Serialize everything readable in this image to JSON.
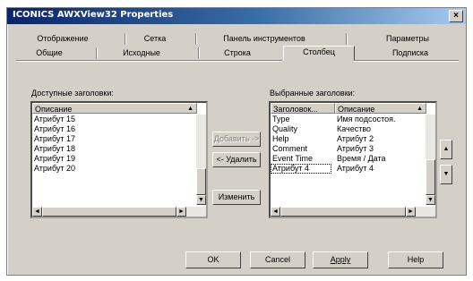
{
  "window": {
    "title": "ICONICS AWXView32 Properties",
    "close_glyph": "×"
  },
  "tabs": {
    "row_top": [
      "Отображение",
      "Сетка",
      "Панель инструментов",
      "Параметры"
    ],
    "row_bottom": [
      "Общие",
      "Исходные",
      "Строка",
      "Столбец",
      "Подписка"
    ],
    "active": "Столбец"
  },
  "available": {
    "label": "Доступные заголовки:",
    "header": "Описание",
    "items": [
      "Атрибут 15",
      "Атрибут 16",
      "Атрибут 17",
      "Атрибут 18",
      "Атрибут 19",
      "Атрибут 20"
    ]
  },
  "selected": {
    "label": "Выбранные заголовки:",
    "headers": [
      "Заголовок...",
      "Описание"
    ],
    "rows": [
      [
        "Type",
        "Имя подсостоя."
      ],
      [
        "Quality",
        "Качество"
      ],
      [
        "Help",
        "Атрибут 2"
      ],
      [
        "Comment",
        "Атрибут 3"
      ],
      [
        "Event Time",
        "Время / Дата"
      ],
      [
        "Атрибут 4",
        "Атрибут 4"
      ]
    ]
  },
  "middle_buttons": {
    "add": "Добавить ->",
    "remove": "<- Удалить",
    "change": "Изменить"
  },
  "bottom_buttons": {
    "ok": "OK",
    "cancel": "Cancel",
    "apply": "Apply",
    "help": "Help"
  },
  "icons": {
    "up_arrow": "▲",
    "down_arrow": "▼",
    "left_arrow": "◄",
    "right_arrow": "►",
    "header_sort": "▲"
  }
}
